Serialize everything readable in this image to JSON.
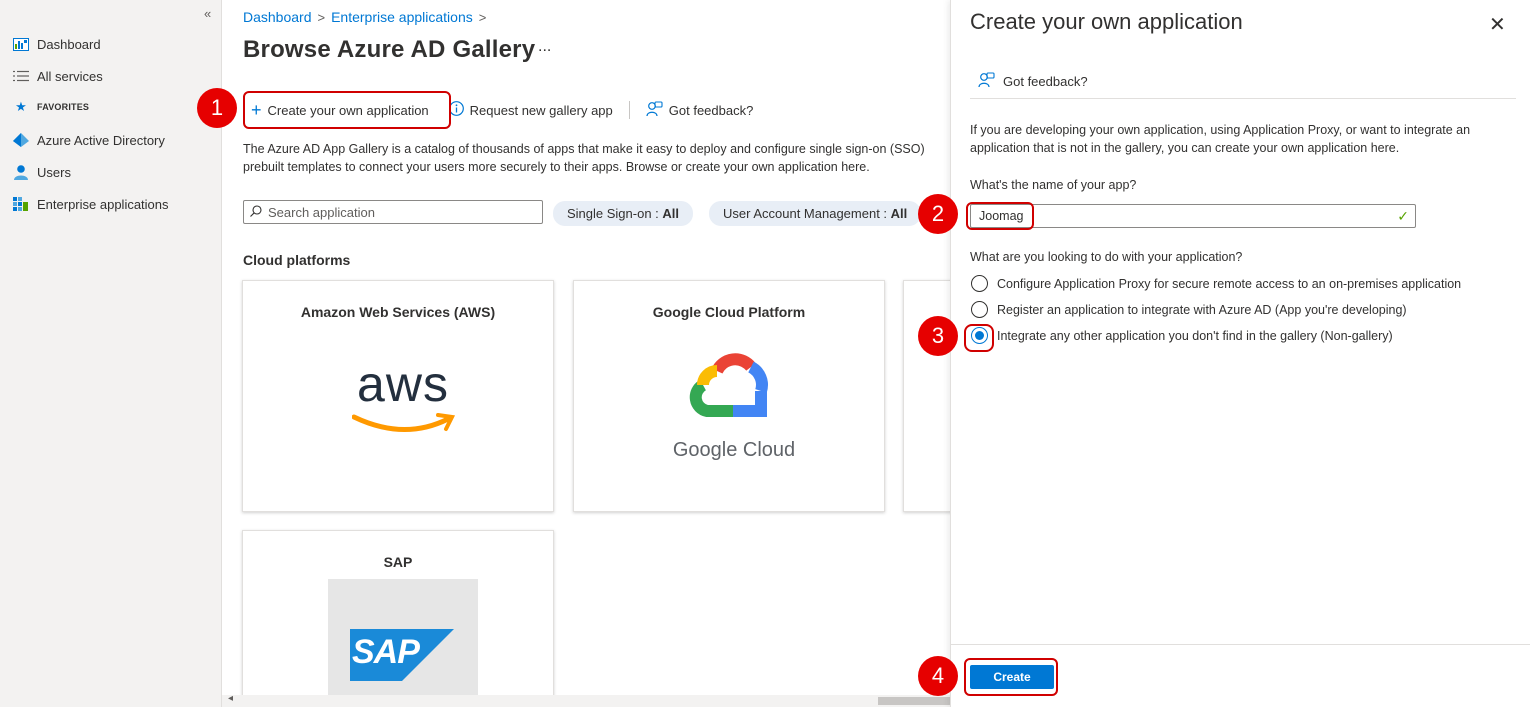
{
  "colors": {
    "accent": "#0078d4",
    "callout": "#e60000",
    "success": "#57a300"
  },
  "sidebar": {
    "collapse_glyph": "«",
    "items": [
      {
        "label": "Dashboard",
        "icon": "dashboard-icon"
      },
      {
        "label": "All services",
        "icon": "list-icon"
      },
      {
        "label": "FAVORITES",
        "icon": "star-icon"
      },
      {
        "label": "Azure Active Directory",
        "icon": "azure-ad-icon"
      },
      {
        "label": "Users",
        "icon": "user-icon"
      },
      {
        "label": "Enterprise applications",
        "icon": "grid-apps-icon"
      }
    ]
  },
  "breadcrumb": {
    "items": [
      "Dashboard",
      "Enterprise applications"
    ],
    "sep": ">"
  },
  "page": {
    "title": "Browse Azure AD Gallery",
    "more": "...",
    "toolbar": {
      "create": "Create your own application",
      "request": "Request new gallery app",
      "feedback": "Got feedback?"
    },
    "description_lines": [
      "The Azure AD App Gallery is a catalog of thousands of apps that make it easy to deploy and configure single sign-on (SSO)",
      "prebuilt templates to connect your users more securely to their apps. Browse or create your own application here."
    ],
    "search_placeholder": "Search application",
    "filters": [
      {
        "label": "Single Sign-on : ",
        "value": "All"
      },
      {
        "label": "User Account Management : ",
        "value": "All"
      }
    ],
    "section": "Cloud platforms",
    "cards": [
      {
        "name": "Amazon Web Services (AWS)",
        "logo_text": "aws"
      },
      {
        "name": "Google Cloud Platform",
        "logo_text": "Google Cloud"
      },
      {
        "name": "SAP",
        "logo_text": "SAP"
      }
    ]
  },
  "panel": {
    "title": "Create your own application",
    "close": "✕",
    "feedback": "Got feedback?",
    "intro": "If you are developing your own application, using Application Proxy, or want to integrate an application that is not in the gallery, you can create your own application here.",
    "name_label": "What's the name of your app?",
    "name_value": "Joomag",
    "purpose_label": "What are you looking to do with your application?",
    "options": [
      {
        "label": "Configure Application Proxy for secure remote access to an on-premises application",
        "selected": false
      },
      {
        "label": "Register an application to integrate with Azure AD (App you're developing)",
        "selected": false
      },
      {
        "label": "Integrate any other application you don't find in the gallery (Non-gallery)",
        "selected": true
      }
    ],
    "create_button": "Create"
  },
  "callouts": [
    "1",
    "2",
    "3",
    "4"
  ]
}
